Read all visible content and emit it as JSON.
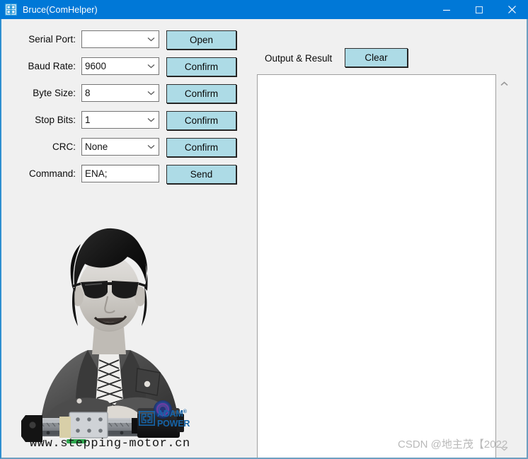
{
  "window": {
    "title": "Bruce(ComHelper)",
    "icon": "com-helper-icon",
    "minimize_label": "—",
    "maximize_label": "□",
    "close_label": "✕",
    "colors": {
      "titlebar": "#0078d7",
      "body": "#f0f0f0",
      "button": "#addbe6",
      "border": "#2e2e2e",
      "field_border": "#767676"
    }
  },
  "form": {
    "rows": [
      {
        "label": "Serial Port:",
        "control": "select",
        "value": "",
        "button": "Open",
        "name": "serial-port"
      },
      {
        "label": "Baud Rate:",
        "control": "select",
        "value": "9600",
        "button": "Confirm",
        "name": "baud-rate"
      },
      {
        "label": "Byte Size:",
        "control": "select",
        "value": "8",
        "button": "Confirm",
        "name": "byte-size"
      },
      {
        "label": "Stop Bits:",
        "control": "select",
        "value": "1",
        "button": "Confirm",
        "name": "stop-bits"
      },
      {
        "label": "CRC:",
        "control": "select",
        "value": "None",
        "button": "Confirm",
        "name": "crc"
      },
      {
        "label": "Command:",
        "control": "input",
        "value": "ENA;",
        "button": "Send",
        "name": "command"
      }
    ]
  },
  "output": {
    "label": "Output & Result",
    "clear_label": "Clear",
    "text": "",
    "scrollbar": {
      "up_arrow": "chevron-up-icon",
      "down_arrow": "chevron-down-icon"
    }
  },
  "banner": {
    "url": "www.stepping-motor.cn",
    "logo_line1": "ADAM",
    "logo_trademark": "®",
    "logo_line2": "POWER",
    "logo_color": "#1664a8",
    "photo_alt": "bruce-lee-photo-with-linear-actuator"
  },
  "watermark": {
    "text": "CSDN @地主茂【2022"
  }
}
